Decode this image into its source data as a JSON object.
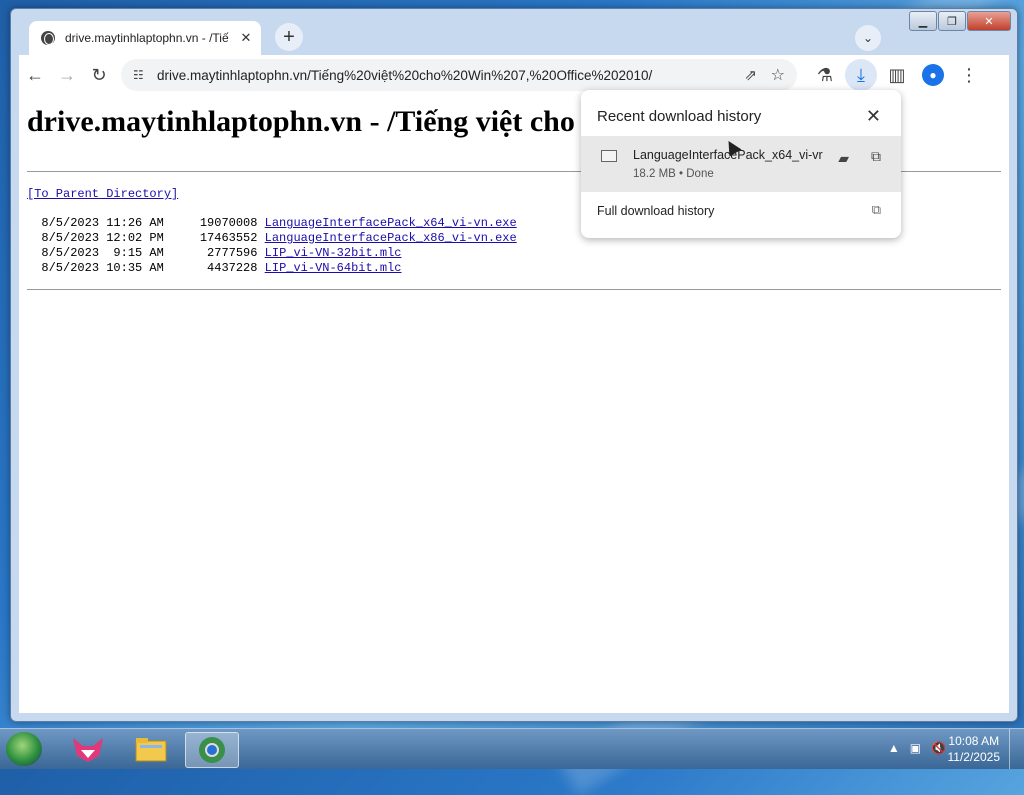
{
  "browser": {
    "tab_title": "drive.maytinhlaptophn.vn - /Tiế",
    "url": "drive.maytinhlaptophn.vn/Tiếng%20việt%20cho%20Win%207,%20Office%202010/"
  },
  "page": {
    "heading": "drive.maytinhlaptophn.vn - /Tiếng việt cho",
    "parent_link": "[To Parent Directory]",
    "files": [
      {
        "date": "8/5/2023 11:26 AM",
        "size": "19070008",
        "name": "LanguageInterfacePack_x64_vi-vn.exe"
      },
      {
        "date": "8/5/2023 12:02 PM",
        "size": "17463552",
        "name": "LanguageInterfacePack_x86_vi-vn.exe"
      },
      {
        "date": "8/5/2023  9:15 AM",
        "size": "2777596",
        "name": "LIP_vi-VN-32bit.mlc"
      },
      {
        "date": "8/5/2023 10:35 AM",
        "size": "4437228",
        "name": "LIP_vi-VN-64bit.mlc"
      }
    ]
  },
  "downloads": {
    "header": "Recent download history",
    "item_name": "LanguageInterfacePack_x64_vi-vr",
    "item_meta": "18.2 MB • Done",
    "full_history": "Full download history"
  },
  "taskbar": {
    "time": "10:08 AM",
    "date": "11/2/2025"
  },
  "colors": {
    "link": "#1a0dab",
    "accent": "#1a73e8"
  }
}
